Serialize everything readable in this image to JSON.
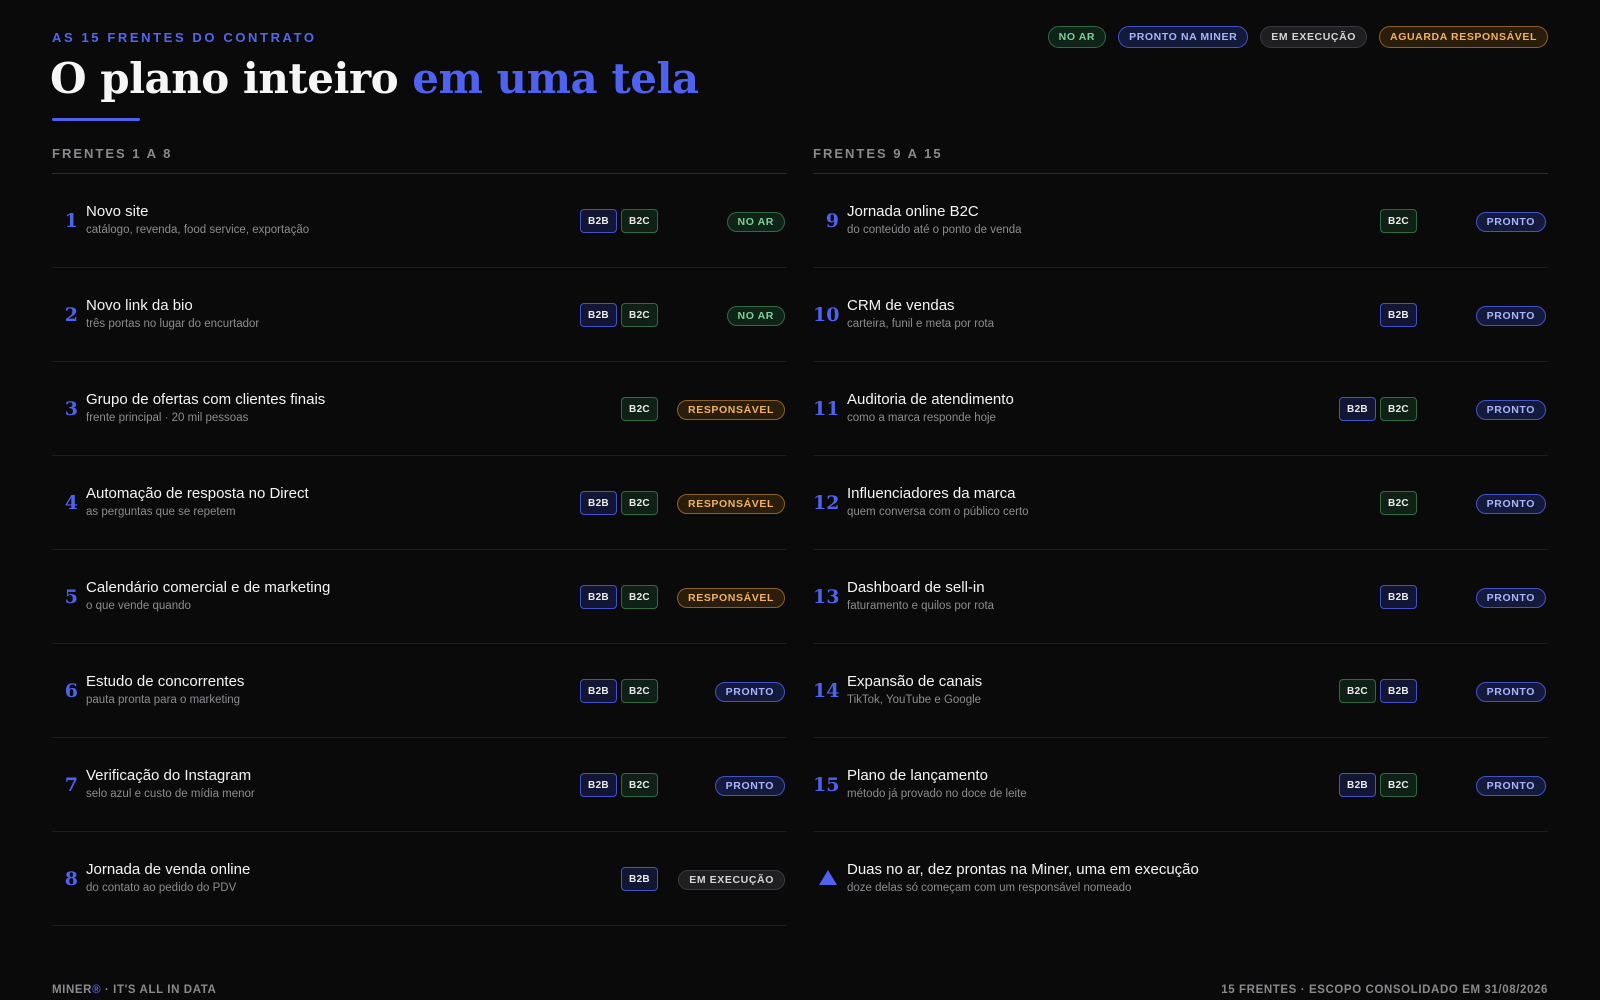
{
  "header": {
    "eyebrow": "AS 15 FRENTES DO CONTRATO",
    "title_main": "O plano inteiro ",
    "title_accent": "em uma tela"
  },
  "legend": [
    {
      "label": "NO AR",
      "status": "noar"
    },
    {
      "label": "PRONTO NA MINER",
      "status": "pronto"
    },
    {
      "label": "EM EXECUÇÃO",
      "status": "exec"
    },
    {
      "label": "AGUARDA RESPONSÁVEL",
      "status": "resp"
    }
  ],
  "columns": [
    {
      "heading": "FRENTES 1 A 8",
      "rows": [
        {
          "num": "1",
          "name": "Novo site",
          "desc": "catálogo, revenda, food service, exportação",
          "tags": [
            "B2B",
            "B2C"
          ],
          "status_label": "NO AR",
          "status": "noar"
        },
        {
          "num": "2",
          "name": "Novo link da bio",
          "desc": "três portas no lugar do encurtador",
          "tags": [
            "B2B",
            "B2C"
          ],
          "status_label": "NO AR",
          "status": "noar"
        },
        {
          "num": "3",
          "name": "Grupo de ofertas com clientes finais",
          "desc": "frente principal · 20 mil pessoas",
          "tags": [
            "B2C"
          ],
          "status_label": "RESPONSÁVEL",
          "status": "resp"
        },
        {
          "num": "4",
          "name": "Automação de resposta no Direct",
          "desc": "as perguntas que se repetem",
          "tags": [
            "B2B",
            "B2C"
          ],
          "status_label": "RESPONSÁVEL",
          "status": "resp"
        },
        {
          "num": "5",
          "name": "Calendário comercial e de marketing",
          "desc": "o que vende quando",
          "tags": [
            "B2B",
            "B2C"
          ],
          "status_label": "RESPONSÁVEL",
          "status": "resp"
        },
        {
          "num": "6",
          "name": "Estudo de concorrentes",
          "desc": "pauta pronta para o marketing",
          "tags": [
            "B2B",
            "B2C"
          ],
          "status_label": "PRONTO",
          "status": "pronto"
        },
        {
          "num": "7",
          "name": "Verificação do Instagram",
          "desc": "selo azul e custo de mídia menor",
          "tags": [
            "B2B",
            "B2C"
          ],
          "status_label": "PRONTO",
          "status": "pronto"
        },
        {
          "num": "8",
          "name": "Jornada de venda online",
          "desc": "do contato ao pedido do PDV",
          "tags": [
            "B2B"
          ],
          "status_label": "EM EXECUÇÃO",
          "status": "exec"
        }
      ]
    },
    {
      "heading": "FRENTES 9 A 15",
      "rows": [
        {
          "num": "9",
          "name": "Jornada online B2C",
          "desc": "do conteúdo até o ponto de venda",
          "tags": [
            "B2C"
          ],
          "status_label": "PRONTO",
          "status": "pronto"
        },
        {
          "num": "10",
          "name": "CRM de vendas",
          "desc": "carteira, funil e meta por rota",
          "tags": [
            "B2B"
          ],
          "status_label": "PRONTO",
          "status": "pronto"
        },
        {
          "num": "11",
          "name": "Auditoria de atendimento",
          "desc": "como a marca responde hoje",
          "tags": [
            "B2B",
            "B2C"
          ],
          "status_label": "PRONTO",
          "status": "pronto"
        },
        {
          "num": "12",
          "name": "Influenciadores da marca",
          "desc": "quem conversa com o público certo",
          "tags": [
            "B2C"
          ],
          "status_label": "PRONTO",
          "status": "pronto"
        },
        {
          "num": "13",
          "name": "Dashboard de sell-in",
          "desc": "faturamento e quilos por rota",
          "tags": [
            "B2B"
          ],
          "status_label": "PRONTO",
          "status": "pronto"
        },
        {
          "num": "14",
          "name": "Expansão de canais",
          "desc": "TikTok, YouTube e Google",
          "tags": [
            "B2C",
            "B2B"
          ],
          "status_label": "PRONTO",
          "status": "pronto"
        },
        {
          "num": "15",
          "name": "Plano de lançamento",
          "desc": "método já provado no doce de leite",
          "tags": [
            "B2B",
            "B2C"
          ],
          "status_label": "PRONTO",
          "status": "pronto"
        }
      ],
      "summary": {
        "icon": "triangle-icon",
        "name": "Duas no ar, dez prontas na Miner, uma em execução",
        "desc": "doze delas só começam com um responsável nomeado"
      }
    }
  ],
  "footer": {
    "brand": "MINER",
    "brand_mark": "®",
    "tagline": " · IT'S ALL IN DATA",
    "right": "15 FRENTES · ESCOPO CONSOLIDADO EM 31/08/2026"
  }
}
